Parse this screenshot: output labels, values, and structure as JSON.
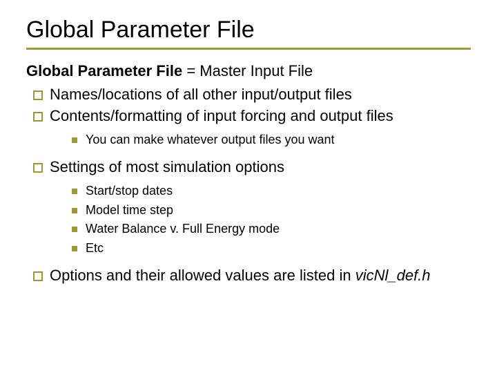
{
  "title": "Global Parameter File",
  "intro": {
    "bold": "Global Parameter File",
    "rest": " = Master Input File"
  },
  "bullets": {
    "b1": "Names/locations of all other input/output files",
    "b2": "Contents/formatting of input forcing and output files",
    "b2_sub": {
      "s1": "You can make whatever output files you want"
    },
    "b3": "Settings of most simulation options",
    "b3_sub": {
      "s1": "Start/stop dates",
      "s2": "Model time step",
      "s3": "Water Balance v. Full Energy mode",
      "s4": "Etc"
    },
    "b4": {
      "text": "Options and their allowed values are listed in ",
      "file": "vicNl_def.h"
    }
  }
}
